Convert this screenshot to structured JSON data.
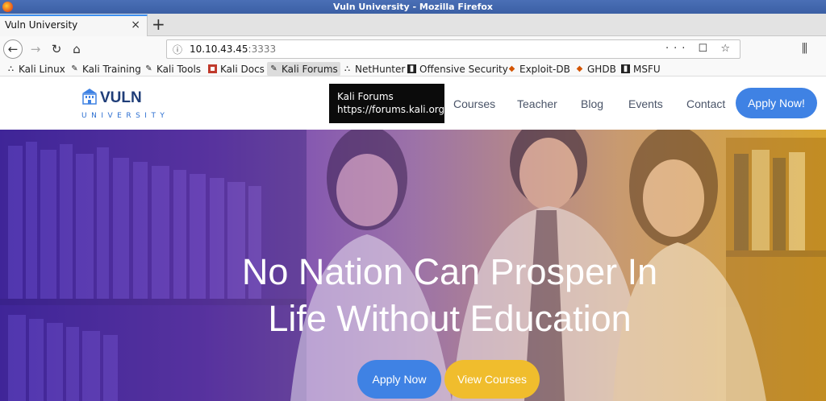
{
  "window": {
    "title": "Vuln University - Mozilla Firefox"
  },
  "tabs": [
    {
      "label": "Vuln University",
      "close": "×"
    }
  ],
  "new_tab": "+",
  "nav": {
    "back": "←",
    "forward": "→",
    "reload": "↻",
    "home": "⌂",
    "url_host": "10.10.43.45",
    "url_port": ":3333",
    "url_actions": "··· ☐ ☆"
  },
  "bookmarks": [
    {
      "label": "Kali Linux",
      "icon": "kali-dragon-icon"
    },
    {
      "label": "Kali Training",
      "icon": "kali-dragon-icon"
    },
    {
      "label": "Kali Tools",
      "icon": "kali-dragon-icon"
    },
    {
      "label": "Kali Docs",
      "icon": "red-doc-icon"
    },
    {
      "label": "Kali Forums",
      "icon": "kali-dragon-icon"
    },
    {
      "label": "NetHunter",
      "icon": "nethunter-icon"
    },
    {
      "label": "Offensive Security",
      "icon": "offsec-icon"
    },
    {
      "label": "Exploit-DB",
      "icon": "exploitdb-icon"
    },
    {
      "label": "GHDB",
      "icon": "exploitdb-icon"
    },
    {
      "label": "MSFU",
      "icon": "offsec-icon"
    }
  ],
  "tooltip": {
    "line1": "Kali Forums",
    "line2": "https://forums.kali.org/"
  },
  "site": {
    "logo_text": "VULN",
    "logo_sub": "UNIVERSITY",
    "nav_links": [
      "Courses",
      "Teacher",
      "Blog",
      "Events",
      "Contact"
    ],
    "cta": "Apply Now!"
  },
  "hero": {
    "line1": "No Nation Can Prosper In",
    "line2": "Life Without Education",
    "apply_button": "Apply Now",
    "courses_button": "View Courses"
  },
  "colors": {
    "accent": "#3f82e4",
    "yellow": "#f0bd2d",
    "navy": "#1f3d78"
  }
}
